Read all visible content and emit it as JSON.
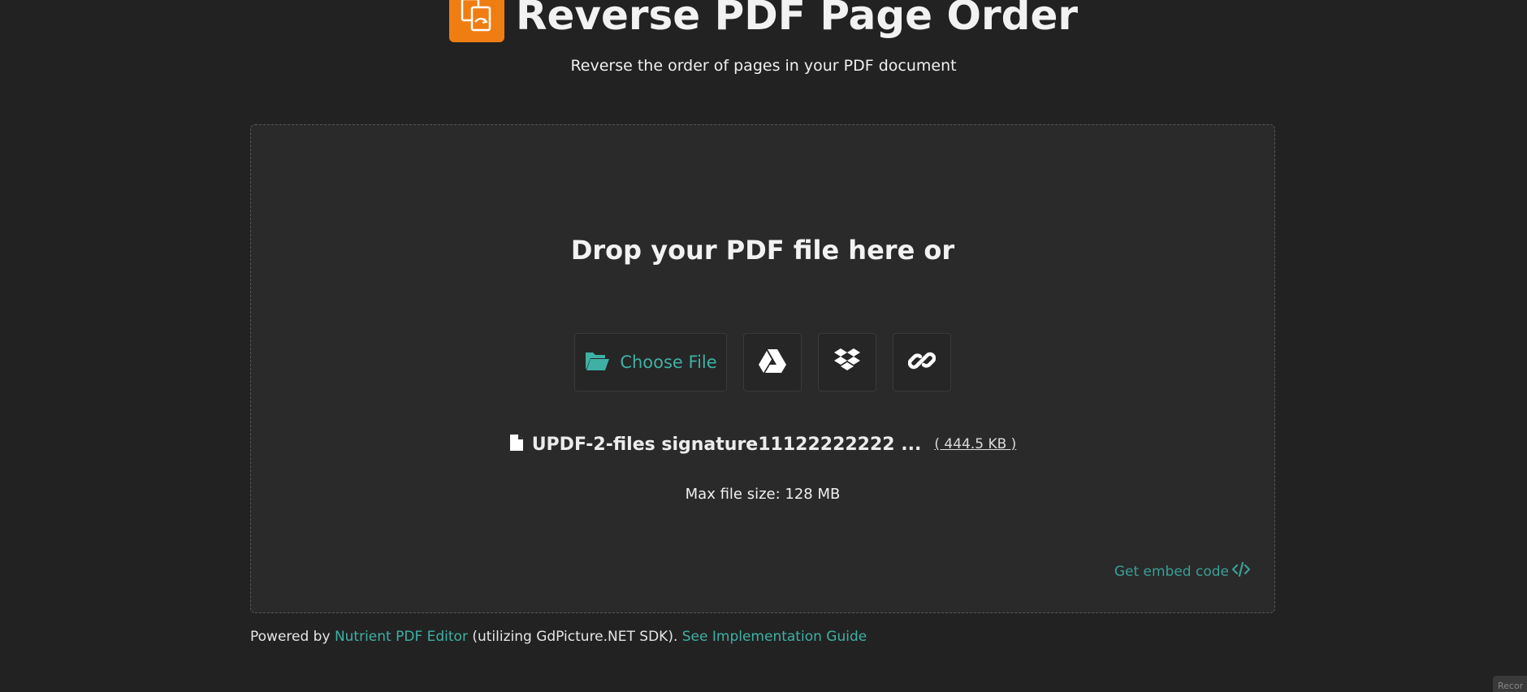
{
  "header": {
    "title": "Reverse PDF Page Order",
    "subtitle": "Reverse the order of pages in your PDF document"
  },
  "dropzone": {
    "title": "Drop your PDF file here or",
    "choose_file_label": "Choose File",
    "icons": {
      "choose": "folder-open-icon",
      "drive": "google-drive-icon",
      "dropbox": "dropbox-icon",
      "link": "link-icon"
    },
    "file": {
      "name": "UPDF-2-files signature11122222222 ...",
      "size": "( 444.5 KB )"
    },
    "max_size": "Max file size: 128 MB",
    "embed_label": "Get embed code"
  },
  "footer": {
    "prefix": "Powered by",
    "product_link": "Nutrient PDF Editor",
    "middle": "(utilizing GdPicture.NET SDK).",
    "guide_link": "See Implementation Guide"
  },
  "corner": {
    "label": "Recor"
  },
  "colors": {
    "background": "#222222",
    "panel": "#2a2a2a",
    "accent": "#3fb0a4",
    "logo": "#f07d12"
  }
}
